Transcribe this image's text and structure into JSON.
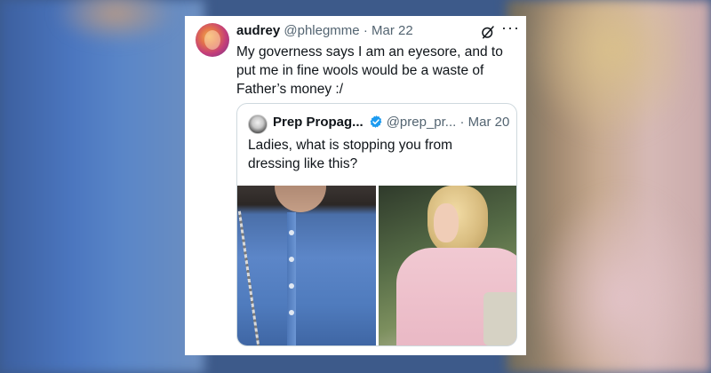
{
  "tweet": {
    "display_name": "audrey",
    "handle": "@phlegmme",
    "separator": "·",
    "date": "Mar 22",
    "more_label": "···",
    "text": "My governess says I am an eyesore, and to put me in fine wools would be a waste of Father’s money :/"
  },
  "quoted_tweet": {
    "display_name": "Prep Propag...",
    "handle": "@prep_pr...",
    "separator": "·",
    "date": "Mar 20",
    "text": "Ladies, what is stopping you from dressing like this?",
    "verified": true,
    "images": [
      {
        "name": "blue-cable-knit-cardigan-photo"
      },
      {
        "name": "pink-cable-knit-sweater-photo"
      }
    ]
  },
  "colors": {
    "verified": "#1d9bf0",
    "text_primary": "#0f1419",
    "text_secondary": "#536471",
    "border": "#cfd9de"
  },
  "icons": {
    "grok": "grok-icon",
    "more": "more-icon",
    "verified": "verified-badge-icon"
  }
}
